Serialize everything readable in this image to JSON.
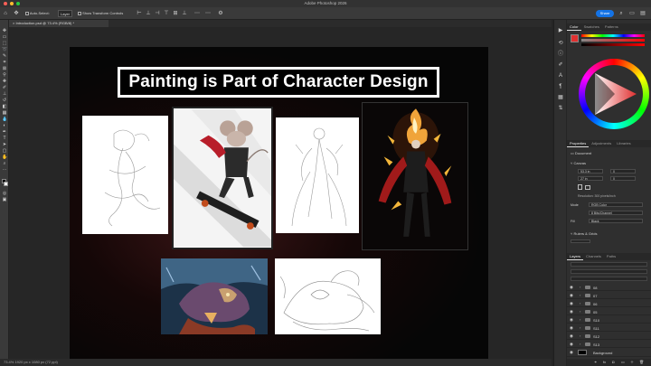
{
  "window": {
    "title": "Adobe Photoshop 2026",
    "controls": [
      "#ff5f57",
      "#febc2e",
      "#28c840"
    ]
  },
  "options_bar": {
    "auto_select_label": "Auto-Select:",
    "auto_select_value": "Layer",
    "transform_label": "Show Transform Controls",
    "share_label": "Share"
  },
  "document": {
    "tab_label": "Introduction.psd @ 73.4% (RGB/8) *",
    "status": "73.4%   1920 px x 1080 px (72 ppi)"
  },
  "slide": {
    "title": "Painting is Part of Character Design"
  },
  "panels": {
    "color_tabs": [
      "Color",
      "Swatches",
      "Patterns"
    ],
    "properties_tabs": [
      "Properties",
      "Adjustments",
      "Libraries"
    ],
    "properties_type": "Document",
    "canvas_section": "Canvas",
    "canvas_w": "53.3 in",
    "canvas_h": "27 in",
    "canvas_x": "0",
    "canvas_y": "0",
    "resolution": "Resolution: 300 pixels/inch",
    "mode_label": "Mode",
    "mode_value": "RGB Color",
    "depth_value": "8 Bits/Channel",
    "fill_label": "Fill",
    "fill_value": "Black",
    "rulers_section": "Rulers & Grids",
    "layers_tabs": [
      "Layers",
      "Channels",
      "Paths"
    ],
    "layers": [
      {
        "name": "08"
      },
      {
        "name": "07"
      },
      {
        "name": "06"
      },
      {
        "name": "05"
      },
      {
        "name": "S10"
      },
      {
        "name": "S11"
      },
      {
        "name": "S12"
      },
      {
        "name": "S13"
      },
      {
        "name": "Background"
      }
    ]
  },
  "colors": {
    "accent": "#1473e6",
    "canvas_bg": "#262626",
    "panel_bg": "#2f2f2f",
    "foreground_swatch": "#000000",
    "background_swatch": "#ffffff",
    "picked_color": "#e03030"
  }
}
